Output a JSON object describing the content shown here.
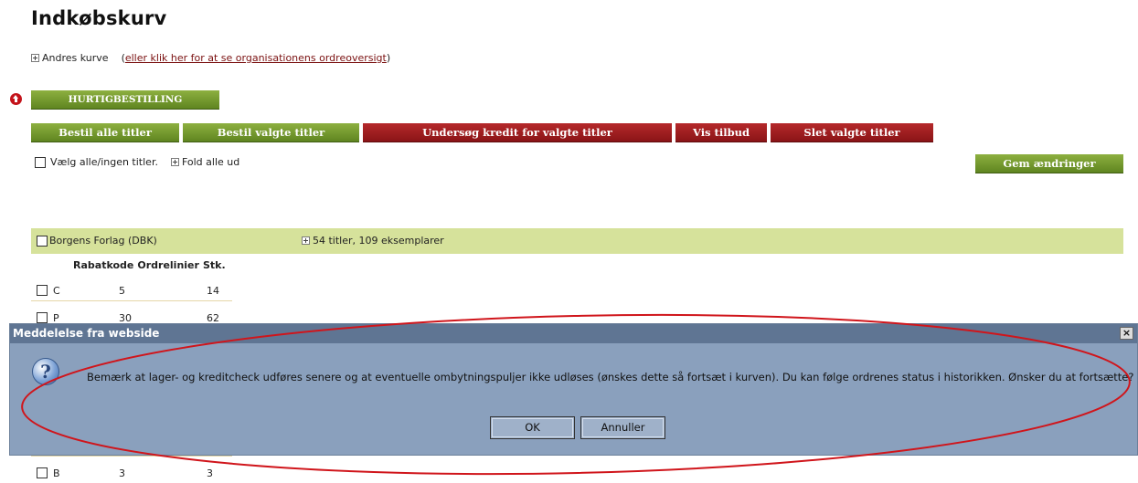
{
  "page": {
    "title": "Indkøbskurv",
    "baskets_toggle_label": "Andres kurve",
    "paren_open": "(",
    "org_link": "eller klik her for at se organisationens ordreoversigt",
    "paren_close": ")"
  },
  "toolbar": {
    "quick_order": "HURTIGBESTILLING",
    "order_all": "Bestil alle titler",
    "order_selected": "Bestil valgte titler",
    "check_credit": "Undersøg kredit for valgte titler",
    "show_offer": "Vis tilbud",
    "delete_selected": "Slet valgte titler",
    "save_changes": "Gem ændringer"
  },
  "selection": {
    "select_all_label": "Vælg alle/ingen titler.",
    "fold_all_label": "Fold alle ud"
  },
  "publisher": {
    "name": "Borgens Forlag (DBK)",
    "summary": "54 titler, 109 eksemplarer"
  },
  "discount_table": {
    "headers": [
      "Rabatkode",
      "Ordrelinier",
      "Stk."
    ],
    "rows": [
      {
        "code": "C",
        "lines": "5",
        "qty": "14"
      },
      {
        "code": "P",
        "lines": "30",
        "qty": "62"
      },
      {
        "code": "B",
        "lines": "3",
        "qty": "3"
      }
    ]
  },
  "dialog": {
    "title": "Meddelelse fra webside",
    "close": "×",
    "help_glyph": "?",
    "message": "Bemærk at lager- og kreditcheck udføres senere og at eventuelle ombytningspuljer ikke udløses (ønskes dette så fortsæt i kurven). Du kan følge ordrenes status i historikken. Ønsker du at fortsætte?",
    "ok": "OK",
    "cancel": "Annuller"
  },
  "colors": {
    "green_button": "#6e9228",
    "red_button": "#9c1b1e",
    "publisher_bar": "#d6e29b",
    "dialog_bg": "#8aa0bd",
    "annotation_ellipse": "#d0151b"
  },
  "icons": [
    "up-arrow-icon",
    "plus-box-icon",
    "help-icon",
    "close-icon",
    "checkbox-icon"
  ]
}
